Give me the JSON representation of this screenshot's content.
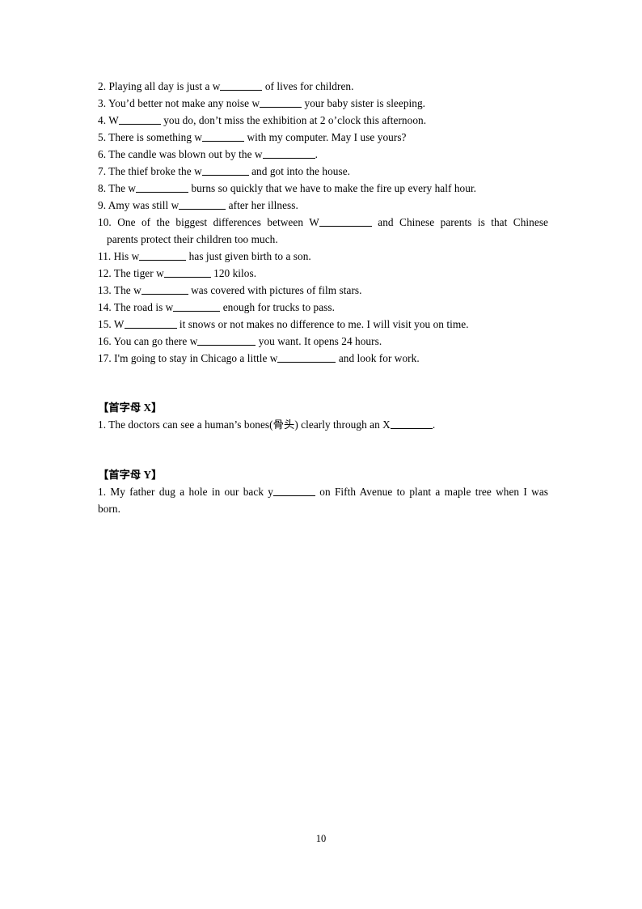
{
  "document": {
    "page_number": "10",
    "sections": [
      {
        "id": "section-w-continued",
        "heading": null,
        "items": [
          {
            "number": "2.",
            "parts": [
              {
                "type": "text",
                "value": "Playing all day is just a w"
              },
              {
                "type": "blank",
                "size": "b7"
              },
              {
                "type": "text",
                "value": " of lives for children."
              }
            ],
            "plain": "2. Playing all day is just a w_______ of lives for children."
          },
          {
            "number": "3.",
            "parts": [
              {
                "type": "text",
                "value": "You’d better not make any noise w"
              },
              {
                "type": "blank",
                "size": "b7"
              },
              {
                "type": "text",
                "value": " your baby sister is sleeping."
              }
            ],
            "plain": "3. You’d better not make any noise w_______ your baby sister is sleeping."
          },
          {
            "number": "4.",
            "parts": [
              {
                "type": "text",
                "value": "W"
              },
              {
                "type": "blank",
                "size": "b7"
              },
              {
                "type": "text",
                "value": " you do, don’t miss the exhibition at 2 o’clock this afternoon."
              }
            ],
            "plain": "4. W_______ you do, don’t miss the exhibition at 2 o’clock this afternoon."
          },
          {
            "number": "5.",
            "parts": [
              {
                "type": "text",
                "value": "There is something w"
              },
              {
                "type": "blank",
                "size": "b7"
              },
              {
                "type": "text",
                "value": " with my computer. May I use yours?"
              }
            ],
            "plain": "5. There is something w_______ with my computer. May I use yours?"
          },
          {
            "number": "6.",
            "parts": [
              {
                "type": "text",
                "value": "The candle was blown out by the w"
              },
              {
                "type": "blank",
                "size": "b9"
              },
              {
                "type": "text",
                "value": "."
              }
            ],
            "plain": "6. The candle was blown out by the w__________."
          },
          {
            "number": "7.",
            "parts": [
              {
                "type": "text",
                "value": "The thief broke the w"
              },
              {
                "type": "blank",
                "size": "b8"
              },
              {
                "type": "text",
                "value": " and got into the house."
              }
            ],
            "plain": "7. The thief broke the w_________ and got into the house."
          },
          {
            "number": "8.",
            "parts": [
              {
                "type": "text",
                "value": "The w"
              },
              {
                "type": "blank",
                "size": "b9"
              },
              {
                "type": "text",
                "value": " burns so quickly that we have to make the fire up every half hour."
              }
            ],
            "plain": "8. The w__________ burns so quickly that we have to make the fire up every half hour."
          },
          {
            "number": "9.",
            "parts": [
              {
                "type": "text",
                "value": "Amy was still w"
              },
              {
                "type": "blank",
                "size": "b8"
              },
              {
                "type": "text",
                "value": " after her illness."
              }
            ],
            "plain": "9. Amy was still w________ after her illness."
          },
          {
            "number": "10.",
            "justified": true,
            "line1_parts": [
              {
                "type": "text",
                "value": "One of the biggest differences between W"
              },
              {
                "type": "blank",
                "size": "b9"
              },
              {
                "type": "text",
                "value": " and Chinese parents is that Chinese"
              }
            ],
            "line2": "parents protect their children too much.",
            "plain": "10. One of the biggest differences between W__________ and Chinese parents is that Chinese parents protect their children too much."
          },
          {
            "number": "11.",
            "parts": [
              {
                "type": "text",
                "value": "His w"
              },
              {
                "type": "blank",
                "size": "b8"
              },
              {
                "type": "text",
                "value": " has just given birth to a son."
              }
            ],
            "plain": "11. His w________ has just given birth to a son."
          },
          {
            "number": "12.",
            "parts": [
              {
                "type": "text",
                "value": "The tiger w"
              },
              {
                "type": "blank",
                "size": "b8"
              },
              {
                "type": "text",
                "value": " 120 kilos."
              }
            ],
            "plain": "12. The tiger w________ 120 kilos."
          },
          {
            "number": "13.",
            "parts": [
              {
                "type": "text",
                "value": "The w"
              },
              {
                "type": "blank",
                "size": "b8"
              },
              {
                "type": "text",
                "value": " was covered with pictures of film stars."
              }
            ],
            "plain": "13. The w________ was covered with pictures of film stars."
          },
          {
            "number": "14.",
            "parts": [
              {
                "type": "text",
                "value": "The road is w"
              },
              {
                "type": "blank",
                "size": "b8"
              },
              {
                "type": "text",
                "value": " enough for trucks to pass."
              }
            ],
            "plain": "14. The road is w________ enough for trucks to pass."
          },
          {
            "number": "15.",
            "parts": [
              {
                "type": "text",
                "value": "W"
              },
              {
                "type": "blank",
                "size": "b9"
              },
              {
                "type": "text",
                "value": " it snows or not makes no difference to me. I will visit you on time."
              }
            ],
            "plain": "15. W__________ it snows or not makes no difference to me. I will visit you on time."
          },
          {
            "number": "16.",
            "parts": [
              {
                "type": "text",
                "value": "You can go there w"
              },
              {
                "type": "blank",
                "size": "b10"
              },
              {
                "type": "text",
                "value": " you want. It opens 24 hours."
              }
            ],
            "plain": "16. You can go there w___________ you want. It opens 24 hours."
          },
          {
            "number": "17.",
            "parts": [
              {
                "type": "text",
                "value": "I'm going to stay in Chicago a little w"
              },
              {
                "type": "blank",
                "size": "b10"
              },
              {
                "type": "text",
                "value": " and look for work."
              }
            ],
            "plain": "17. I'm going to stay in Chicago a little w___________ and look for work."
          }
        ]
      },
      {
        "id": "section-x",
        "heading": "【首字母 X】",
        "items": [
          {
            "number": "1.",
            "parts": [
              {
                "type": "text",
                "value": "The doctors can see a human’s bones(骨头) clearly through an X"
              },
              {
                "type": "blank",
                "size": "b7"
              },
              {
                "type": "text",
                "value": "."
              }
            ],
            "plain": "1. The doctors can see a human’s bones(骨头) clearly through an X_______."
          }
        ]
      },
      {
        "id": "section-y",
        "heading": "【首字母 Y】",
        "items": [
          {
            "number": "1.",
            "wrapped": true,
            "line1_parts": [
              {
                "type": "text",
                "value": "My father dug a hole in our back y"
              },
              {
                "type": "blank",
                "size": "b7"
              },
              {
                "type": "text",
                "value": " on Fifth Avenue to plant a maple tree when I was"
              }
            ],
            "line2": "born.",
            "plain": "1. My father dug a hole in our back y_______ on Fifth Avenue to plant a maple tree when I was born."
          }
        ]
      }
    ]
  }
}
